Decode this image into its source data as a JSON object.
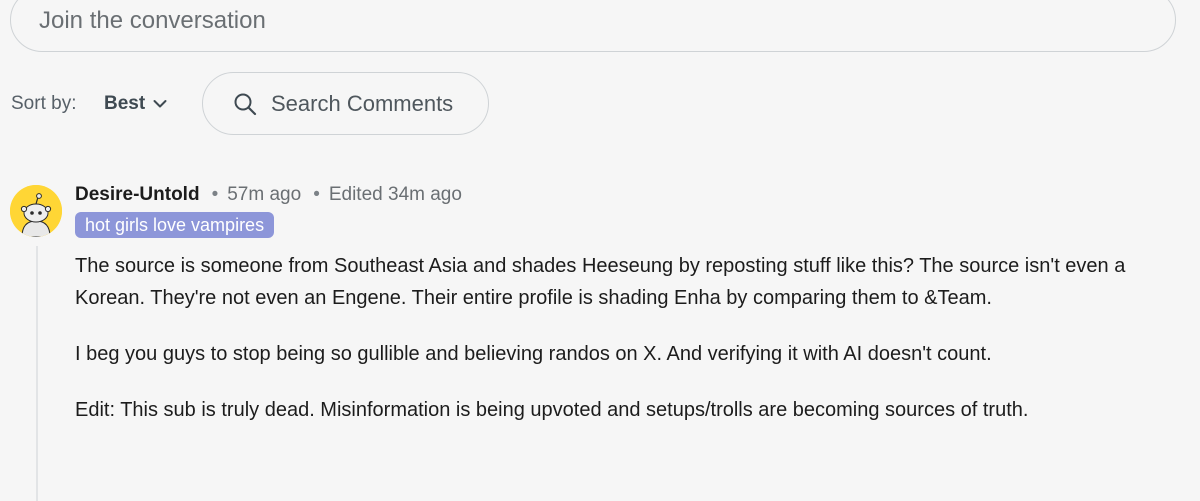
{
  "join": {
    "placeholder": "Join the conversation"
  },
  "sort": {
    "label": "Sort by:",
    "value": "Best"
  },
  "search": {
    "label": "Search Comments"
  },
  "comment": {
    "username": "Desire-Untold",
    "posted": "57m ago",
    "edited": "Edited 34m ago",
    "flair": "hot girls love vampires",
    "paragraphs": [
      "The source is someone from Southeast Asia and shades Heeseung by reposting stuff like this? The source isn't even a Korean. They're not even an Engene. Their entire profile is shading Enha by comparing them to &Team.",
      "I beg you guys to stop being so gullible and believing randos on X. And verifying it with AI doesn't count.",
      "Edit: This sub is truly dead. Misinformation is being upvoted and setups/trolls are becoming sources of truth."
    ]
  },
  "colors": {
    "flair_bg": "#8d96d9",
    "avatar_bg": "#ffd635",
    "background": "#f6f6f6"
  }
}
